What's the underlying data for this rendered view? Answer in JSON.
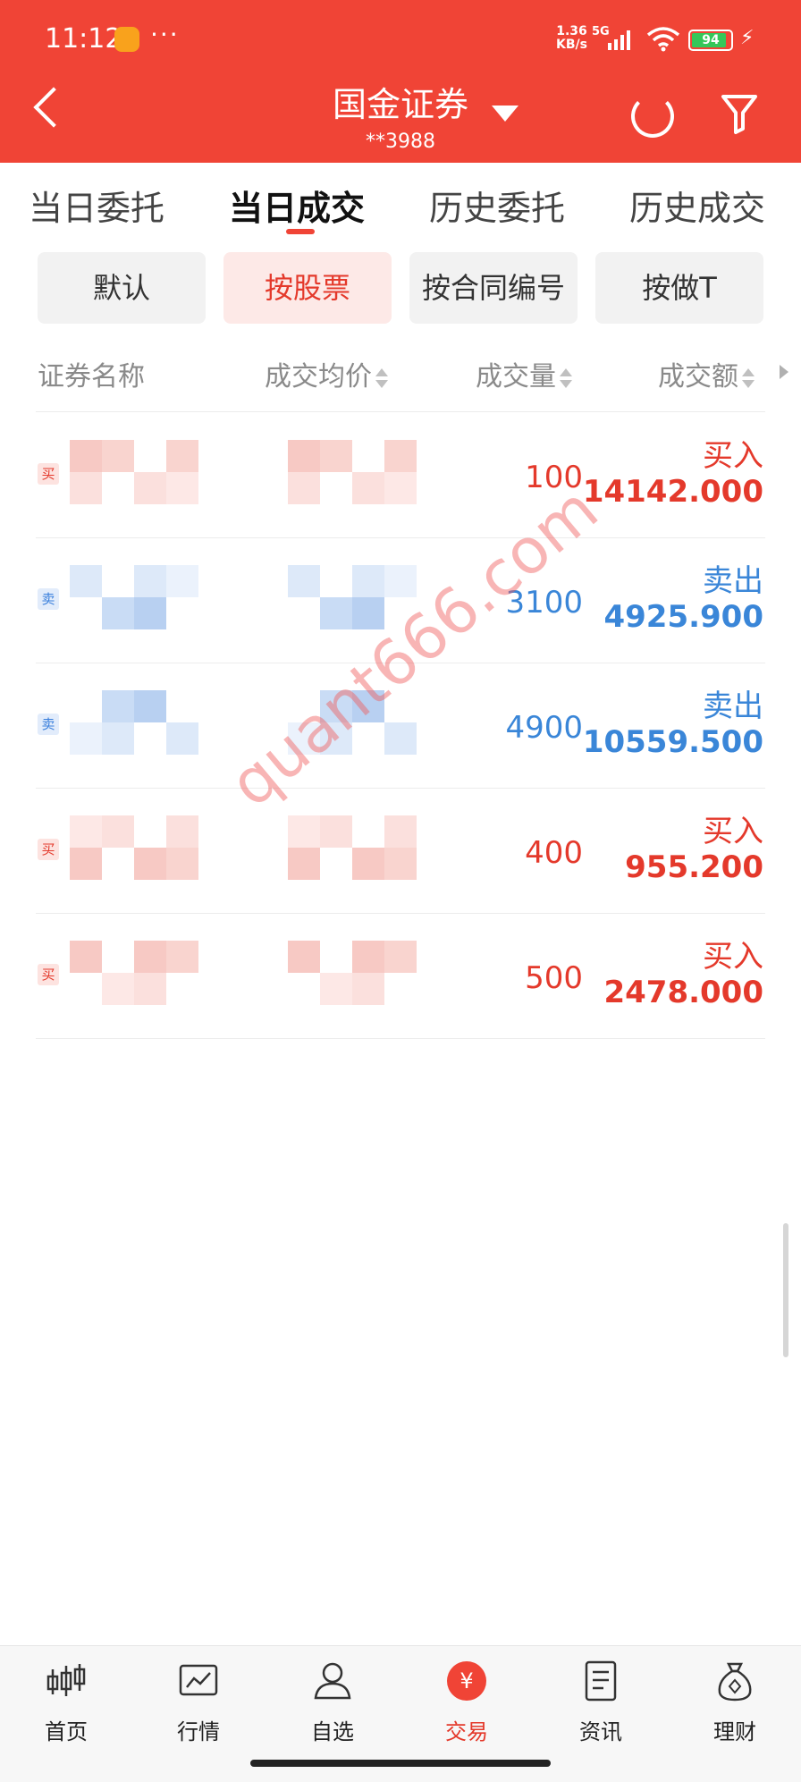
{
  "status_bar": {
    "time": "11:12",
    "net_speed_value": "1.36",
    "net_speed_unit": "KB/s",
    "network": "5G",
    "battery": "94"
  },
  "header": {
    "title": "国金证券",
    "account": "**3988"
  },
  "tabs": [
    {
      "label": "当日委托",
      "active": false
    },
    {
      "label": "当日成交",
      "active": true
    },
    {
      "label": "历史委托",
      "active": false
    },
    {
      "label": "历史成交",
      "active": false
    }
  ],
  "filters": [
    {
      "label": "默认",
      "active": false
    },
    {
      "label": "按股票",
      "active": true
    },
    {
      "label": "按合同编号",
      "active": false
    },
    {
      "label": "按做T",
      "active": false
    }
  ],
  "columns": [
    "证券名称",
    "成交均价",
    "成交量",
    "成交额"
  ],
  "rows": [
    {
      "side": "买",
      "direction": "买入",
      "quantity": "100",
      "amount": "14142.000",
      "color": "#e4392b"
    },
    {
      "side": "卖",
      "direction": "卖出",
      "quantity": "3100",
      "amount": "4925.900",
      "color": "#3a86d8"
    },
    {
      "side": "卖",
      "direction": "卖出",
      "quantity": "4900",
      "amount": "10559.500",
      "color": "#3a86d8"
    },
    {
      "side": "买",
      "direction": "买入",
      "quantity": "400",
      "amount": "955.200",
      "color": "#e4392b"
    },
    {
      "side": "买",
      "direction": "买入",
      "quantity": "500",
      "amount": "2478.000",
      "color": "#e4392b"
    }
  ],
  "watermark": "quant666.com",
  "bottom_nav": [
    {
      "label": "首页",
      "icon": "candlestick-icon"
    },
    {
      "label": "行情",
      "icon": "chart-icon"
    },
    {
      "label": "自选",
      "icon": "user-icon"
    },
    {
      "label": "交易",
      "icon": "yuan-icon",
      "active": true
    },
    {
      "label": "资讯",
      "icon": "document-icon"
    },
    {
      "label": "理财",
      "icon": "money-bag-icon"
    }
  ],
  "colors": {
    "brand": "#f04436",
    "buy": "#e4392b",
    "sell": "#3a86d8"
  }
}
